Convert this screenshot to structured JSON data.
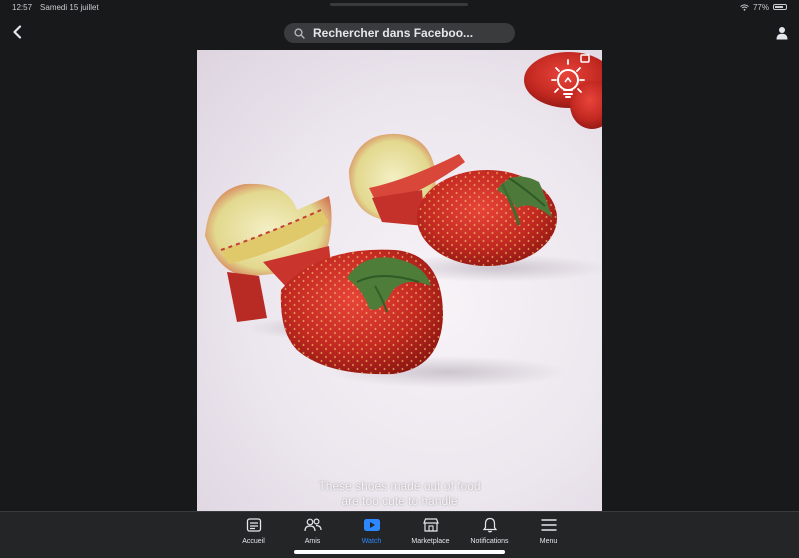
{
  "status_bar": {
    "time": "12:57",
    "date": "Samedi 15 juillet",
    "battery": "77%",
    "battery_level": 0.77
  },
  "header": {
    "search_text": "Rechercher dans Faceboo...",
    "back_icon": "chevron-left-icon",
    "profile_icon": "person-icon"
  },
  "video": {
    "caption_lines": [
      "These shoes made out of food",
      "are too cute to handle"
    ],
    "overlay_icon": "lightbulb-icon"
  },
  "tab_bar": {
    "active_color": "#2d88ff",
    "tabs": [
      {
        "label": "Accueil",
        "icon": "home-feed-icon"
      },
      {
        "label": "Amis",
        "icon": "friends-icon"
      },
      {
        "label": "Watch",
        "icon": "watch-play-icon",
        "active": true
      },
      {
        "label": "Marketplace",
        "icon": "marketplace-shop-icon"
      },
      {
        "label": "Notifications",
        "icon": "bell-icon"
      },
      {
        "label": "Menu",
        "icon": "hamburger-menu-icon"
      }
    ]
  }
}
